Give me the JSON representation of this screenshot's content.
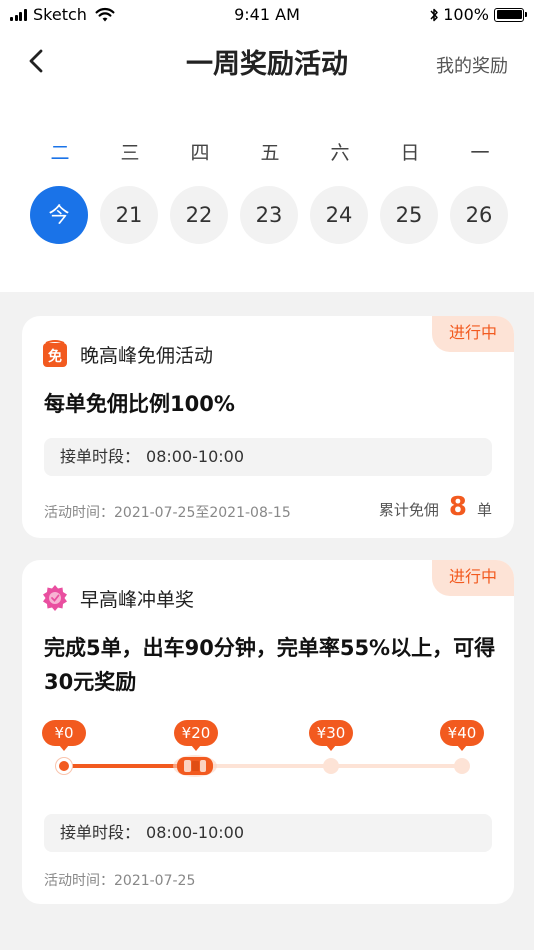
{
  "status_bar": {
    "carrier": "Sketch",
    "time": "9:41 AM",
    "battery": "100%"
  },
  "nav": {
    "title": "一周奖励活动",
    "right_label": "我的奖励"
  },
  "week": {
    "weekdays": [
      "二",
      "三",
      "四",
      "五",
      "六",
      "日",
      "一"
    ],
    "dates": [
      "今",
      "21",
      "22",
      "23",
      "24",
      "25",
      "26"
    ],
    "active_index": 0
  },
  "cards": [
    {
      "status": "进行中",
      "icon": "mian-badge-icon",
      "icon_text": "免",
      "name": "晚高峰免佣活动",
      "desc": "每单免佣比例100%",
      "period_label": "接单时段：",
      "period_value": "08:00-10:00",
      "time_label": "活动时间：",
      "time_value": "2021-07-25至2021-08-15",
      "total_label": "累计免佣",
      "total_value": "8",
      "total_unit": "单"
    },
    {
      "status": "进行中",
      "icon": "medal-icon",
      "name": "早高峰冲单奖",
      "desc": "完成5单，出车90分钟，完单率55%以上，可得30元奖励",
      "progress": {
        "milestones": [
          "¥0",
          "¥20",
          "¥30",
          "¥40"
        ],
        "current_fraction": 0.33
      },
      "period_label": "接单时段：",
      "period_value": "08:00-10:00",
      "time_label": "活动时间：",
      "time_value": "2021-07-25"
    }
  ],
  "colors": {
    "primary": "#1a73e8",
    "accent": "#f25a1f",
    "accent_light": "#fde3d6",
    "background": "#f2f2f2"
  }
}
